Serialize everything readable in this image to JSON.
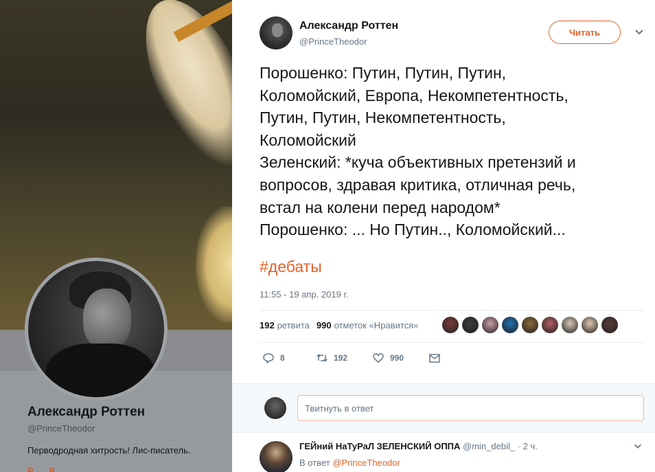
{
  "background_profile": {
    "name": "Александр Роттен",
    "handle": "@PrinceTheodor",
    "bio": "Перводродная хитрость! Лис-писатель.",
    "location_partial": "Р... ...В..."
  },
  "tweet": {
    "author_name": "Александр Роттен",
    "author_handle": "@PrinceTheodor",
    "follow_label": "Читать",
    "text": "Порошенко: Путин, Путин, Путин,\nКоломойский, Европа, Некомпетентность,\nПутин, Путин, Некомпетентность,\nКоломойский\nЗеленский: *куча объективных претензий и\nвопросов, здравая критика, отличная речь,\nвстал на колени перед народом*\nПорошенко: ... Но Путин.., Коломойский...",
    "hashtag": "#дебаты",
    "timestamp": "11:55 - 19 апр. 2019 г.",
    "retweets_count": "192",
    "retweets_label": "ретвита",
    "likes_count": "990",
    "likes_label": "отметок «Нравится»",
    "actions": {
      "reply_count": "8",
      "retweet_count": "192",
      "like_count": "990"
    }
  },
  "likers_colors": [
    "#7a3b3b",
    "#3a3a3a",
    "#c9a0a8",
    "#1e6fb0",
    "#8a6a3a",
    "#b06060",
    "#d8c8b8",
    "#e0c8b0",
    "#5a3a3a"
  ],
  "reply_box": {
    "placeholder": "Твитнуть в ответ"
  },
  "reply_tweet": {
    "name": "ГЕЙний НаТуРаЛ ЗЕЛЕНСКИЙ ОППА",
    "handle": "@min_debil_",
    "time": "· 2 ч.",
    "in_reply_prefix": "В ответ",
    "in_reply_mention": "@PrinceTheodor"
  },
  "colors": {
    "accent": "#e0622b",
    "text": "#14171a",
    "muted": "#657786"
  }
}
